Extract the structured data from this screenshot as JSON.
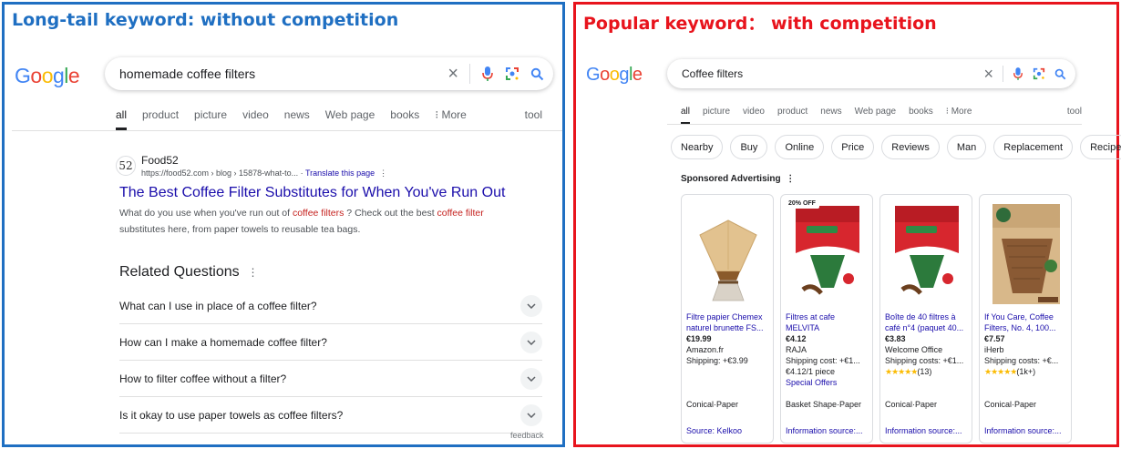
{
  "left": {
    "heading": "Long-tail keyword: without competition",
    "logo": [
      "G",
      "o",
      "o",
      "g",
      "l",
      "e"
    ],
    "query": "homemade coffee filters",
    "tabs": [
      "all",
      "product",
      "picture",
      "video",
      "news",
      "Web page",
      "books",
      "⁝ More"
    ],
    "tool": "tool",
    "result": {
      "favicon": "52",
      "site": "Food52",
      "cite": "https://food52.com › blog › 15878-what-to... ·",
      "translate": "Translate this page",
      "menu": "⋮",
      "title": "The Best Coffee Filter Substitutes for When You've Run Out",
      "snippet_1": "What do you use when you've run out of ",
      "snippet_hl_1": "coffee filters",
      "snippet_2": " ? Check out the best ",
      "snippet_hl_2": "coffee filter",
      "snippet_3": " substitutes here, from paper towels to reusable tea bags."
    },
    "related_title": "Related Questions",
    "related_menu": "⋮",
    "questions": [
      "What can I use in place of a coffee filter?",
      "How can I make a homemade coffee filter?",
      "How to filter coffee without a filter?",
      "Is it okay to use paper towels as coffee filters?"
    ],
    "feedback": "feedback"
  },
  "right": {
    "heading": "Popular keyword： with competition",
    "logo": [
      "G",
      "o",
      "o",
      "g",
      "l",
      "e"
    ],
    "query": "Coffee filters",
    "tabs": [
      "all",
      "picture",
      "video",
      "product",
      "news",
      "Web page",
      "books",
      "⁝ More"
    ],
    "tool": "tool",
    "chips": [
      "Nearby",
      "Buy",
      "Online",
      "Price",
      "Reviews",
      "Man",
      "Replacement",
      "Recipe"
    ],
    "sponsored": "Sponsored Advertising",
    "sponsored_menu": "⋮",
    "products": [
      {
        "name_1": "Filtre papier Chemex",
        "name_2": "naturel brunette FS...",
        "price": "€19.99",
        "seller": "Amazon.fr",
        "shipping": "Shipping: +€3.99",
        "type": "Conical·Paper",
        "source": "Source: Kelkoo"
      },
      {
        "badge": "20% OFF",
        "name_1": "Filtres at cafe",
        "name_2": "MELVITA",
        "price": "€4.12",
        "seller": "RAJA",
        "shipping": "Shipping cost: +€1...",
        "unit": "€4.12/1 piece",
        "offers": "Special Offers",
        "type": "Basket Shape·Paper",
        "source": "Information source:..."
      },
      {
        "name_1": "Boîte de 40 filtres à",
        "name_2": "café n°4 (paquet 40...",
        "price": "€3.83",
        "seller": "Welcome Office",
        "shipping": "Shipping costs: +€1...",
        "stars": "★★★★★",
        "rating": "(13)",
        "type": "Conical·Paper",
        "source": "Information source:..."
      },
      {
        "name_1": "If You Care, Coffee",
        "name_2": "Filters, No. 4, 100...",
        "price": "€7.57",
        "seller": "iHerb",
        "shipping": "Shipping costs: +€...",
        "stars": "★★★★★",
        "rating": "(1k+)",
        "type": "Conical·Paper",
        "source": "Information source:..."
      }
    ]
  },
  "colors": {
    "left_border": "#1f6fc2",
    "right_border": "#e8141d",
    "link": "#1a0dab",
    "highlight": "#c5221f"
  }
}
